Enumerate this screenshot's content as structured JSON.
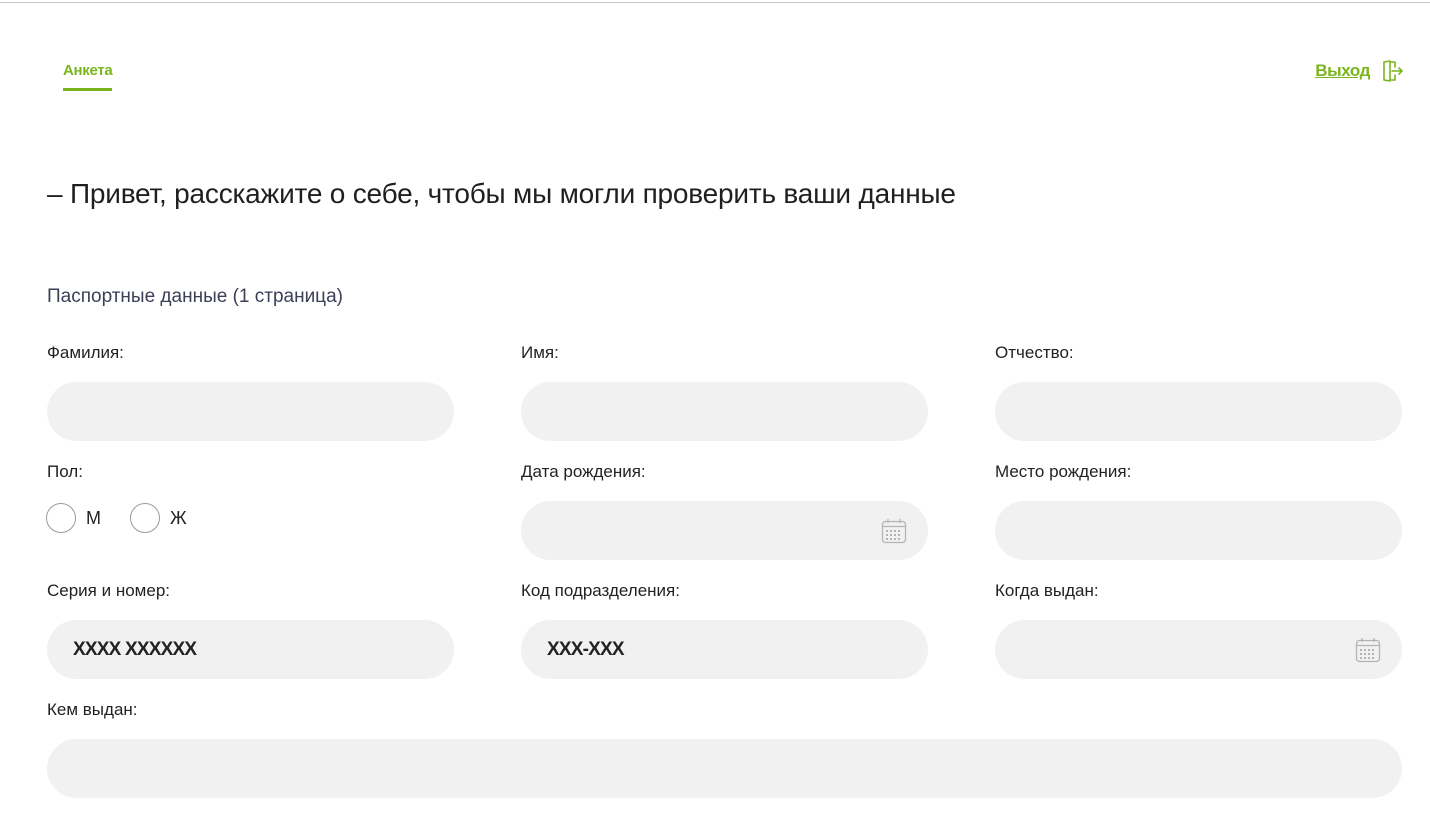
{
  "nav": {
    "tab_label": "Анкета",
    "logout_label": "Выход",
    "logout_icon": "logout-icon"
  },
  "greeting": "– Привет, расскажите о себе, чтобы мы могли проверить ваши данные",
  "section_title": "Паспортные данные (1 страница)",
  "fields": {
    "surname": {
      "label": "Фамилия:",
      "value": "",
      "placeholder": ""
    },
    "name": {
      "label": "Имя:",
      "value": "",
      "placeholder": ""
    },
    "patronymic": {
      "label": "Отчество:",
      "value": "",
      "placeholder": ""
    },
    "gender": {
      "label": "Пол:",
      "options": [
        "М",
        "Ж"
      ],
      "selected": ""
    },
    "birth_date": {
      "label": "Дата рождения:",
      "value": "",
      "placeholder": "",
      "icon": "calendar-icon"
    },
    "birth_place": {
      "label": "Место рождения:",
      "value": "",
      "placeholder": ""
    },
    "series_number": {
      "label": "Серия и номер:",
      "value": "",
      "placeholder": "XXXX XXXXXX"
    },
    "division_code": {
      "label": "Код подразделения:",
      "value": "",
      "placeholder": "XXX-XXX"
    },
    "issue_date": {
      "label": "Когда выдан:",
      "value": "",
      "placeholder": "",
      "icon": "calendar-icon"
    },
    "issued_by": {
      "label": "Кем выдан:",
      "value": "",
      "placeholder": ""
    }
  },
  "colors": {
    "accent": "#7ab51d",
    "field_bg": "#f1f1f2",
    "section_title": "#3b3f57"
  }
}
